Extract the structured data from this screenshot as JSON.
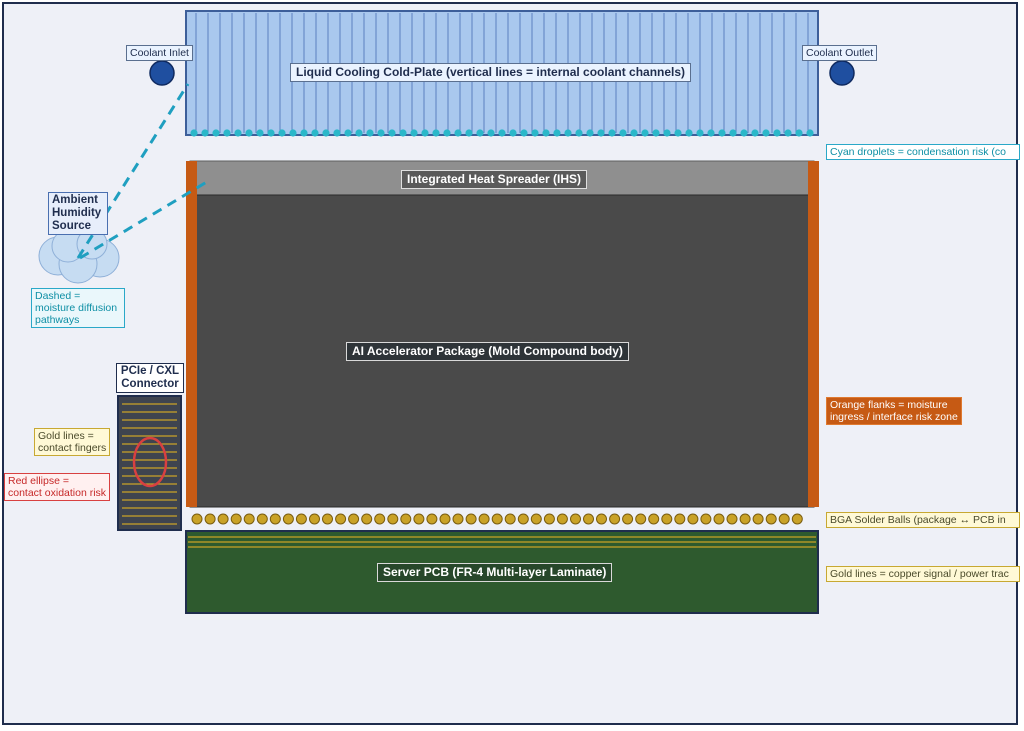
{
  "labels": {
    "cold_plate": "Liquid Cooling Cold-Plate  (vertical lines = internal coolant channels)",
    "coolant_inlet": "Coolant Inlet",
    "coolant_outlet": "Coolant Outlet",
    "ihs": "Integrated Heat Spreader (IHS)",
    "package": "AI Accelerator Package  (Mold Compound body)",
    "pcb": "Server PCB  (FR-4 Multi-layer Laminate)",
    "connector_line1": "PCIe / CXL",
    "connector_line2": "Connector",
    "ambient_line1": "Ambient",
    "ambient_line2": "Humidity",
    "ambient_line3": "Source"
  },
  "notes": {
    "cyan_droplets": "Cyan droplets = condensation risk  (co",
    "orange_line1": "Orange flanks = moisture",
    "orange_line2": "ingress / interface risk zone",
    "bga": "BGA Solder Balls  (package ↔ PCB in",
    "gold_pcb": "Gold lines = copper signal / power trac",
    "dashed_line1": "Dashed =",
    "dashed_line2": "moisture diffusion",
    "dashed_line3": "pathways",
    "gold_line1": "Gold lines =",
    "gold_line2": "contact fingers",
    "red_line1": "Red ellipse =",
    "red_line2": "contact oxidation risk"
  },
  "colors": {
    "cold_plate_fill": "#a9c8ee",
    "channel_line": "#5a7fc0",
    "droplet": "#2ab7c9",
    "ihs_fill": "#8f8f8f",
    "package_fill": "#4a4a4a",
    "flank_orange": "#c65a14",
    "solder_gold": "#c9a227",
    "pcb_fill": "#2e5a2e",
    "trace_gold": "#c9a227",
    "connector_fill": "#3f444f",
    "oxidation_red": "#d84040",
    "diffusion_dash": "#1f9fc0",
    "port_blue": "#1f4fa0"
  }
}
